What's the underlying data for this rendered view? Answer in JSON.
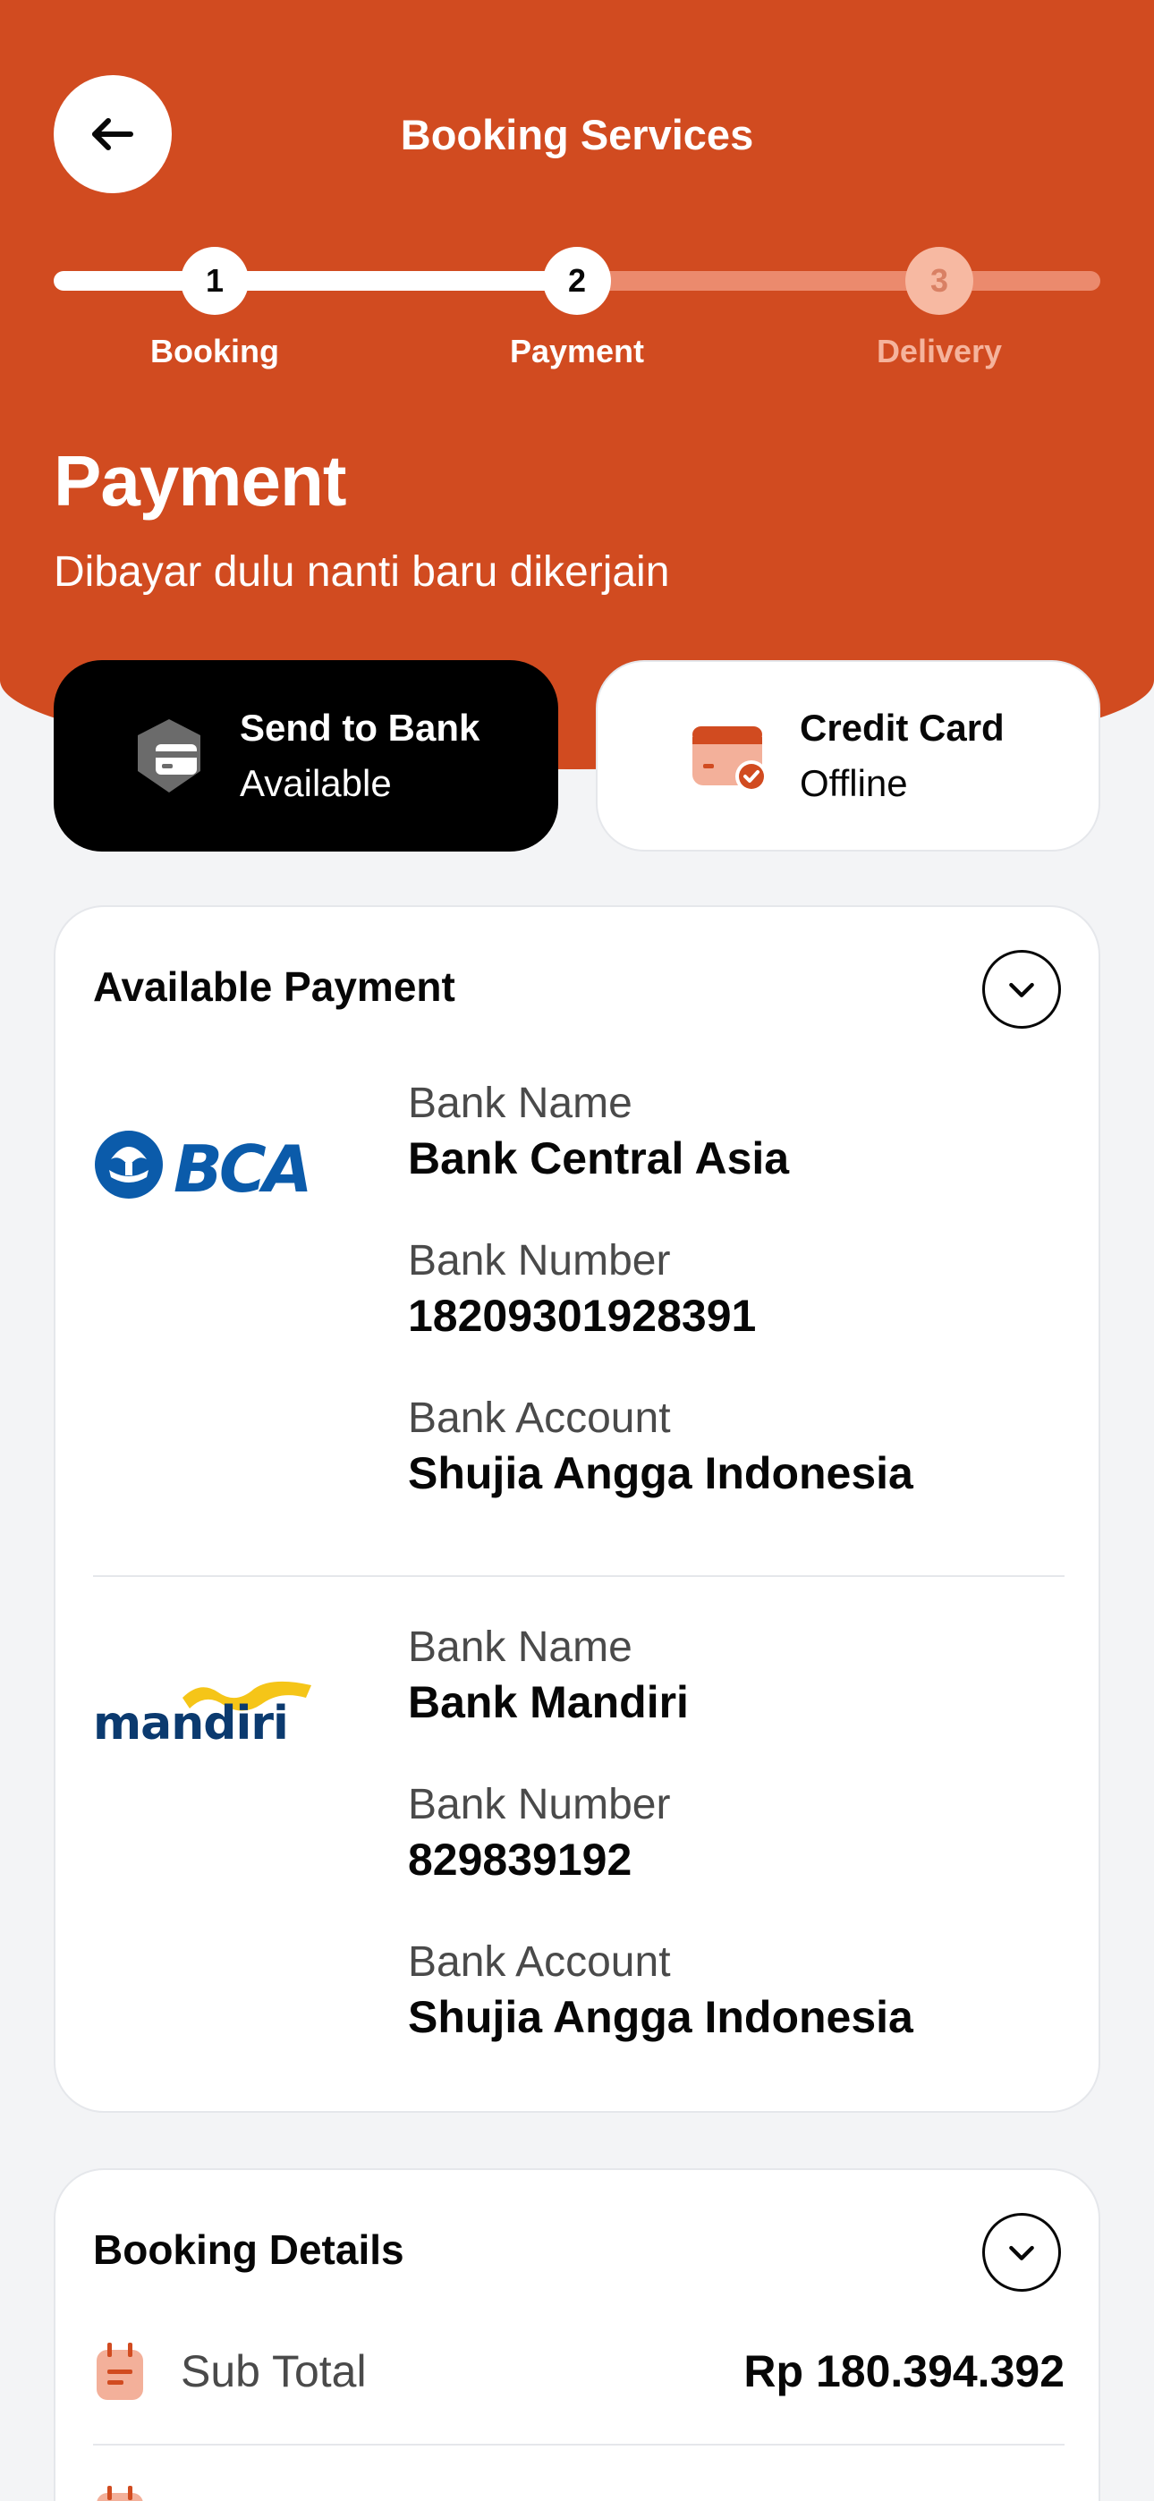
{
  "header": {
    "title": "Booking Services",
    "back_icon": "arrow-left-icon"
  },
  "stepper": {
    "steps": [
      {
        "number": "1",
        "label": "Booking",
        "state": "completed"
      },
      {
        "number": "2",
        "label": "Payment",
        "state": "active"
      },
      {
        "number": "3",
        "label": "Delivery",
        "state": "upcoming"
      }
    ]
  },
  "page": {
    "title": "Payment",
    "subtitle": "Dibayar dulu nanti baru dikerjain"
  },
  "methods": [
    {
      "name": "Send to Bank",
      "status": "Available",
      "icon": "bank-card-shield-icon",
      "selected": true
    },
    {
      "name": "Credit Card",
      "status": "Offline",
      "icon": "credit-card-check-icon",
      "selected": false
    }
  ],
  "available_payment": {
    "title": "Available Payment",
    "banks": [
      {
        "logo": "BCA",
        "bank_name_label": "Bank Name",
        "bank_name": "Bank Central Asia",
        "bank_number_label": "Bank Number",
        "bank_number": "18209301928391",
        "bank_account_label": "Bank Account",
        "bank_account": "Shujia Angga Indonesia"
      },
      {
        "logo": "mandiri",
        "bank_name_label": "Bank Name",
        "bank_name": "Bank Mandiri",
        "bank_number_label": "Bank Number",
        "bank_number": "829839192",
        "bank_account_label": "Bank Account",
        "bank_account": "Shujia Angga Indonesia"
      }
    ]
  },
  "booking_details": {
    "title": "Booking Details",
    "rows": [
      {
        "label": "Sub Total",
        "value": "Rp 180.394.392",
        "icon": "note-icon"
      }
    ]
  },
  "colors": {
    "brand": "#D14B20",
    "dark": "#000000",
    "background": "#F3F4F6",
    "bca_blue": "#0B5BAA",
    "mandiri_navy": "#0B3A6F",
    "mandiri_yellow": "#F5C518"
  }
}
